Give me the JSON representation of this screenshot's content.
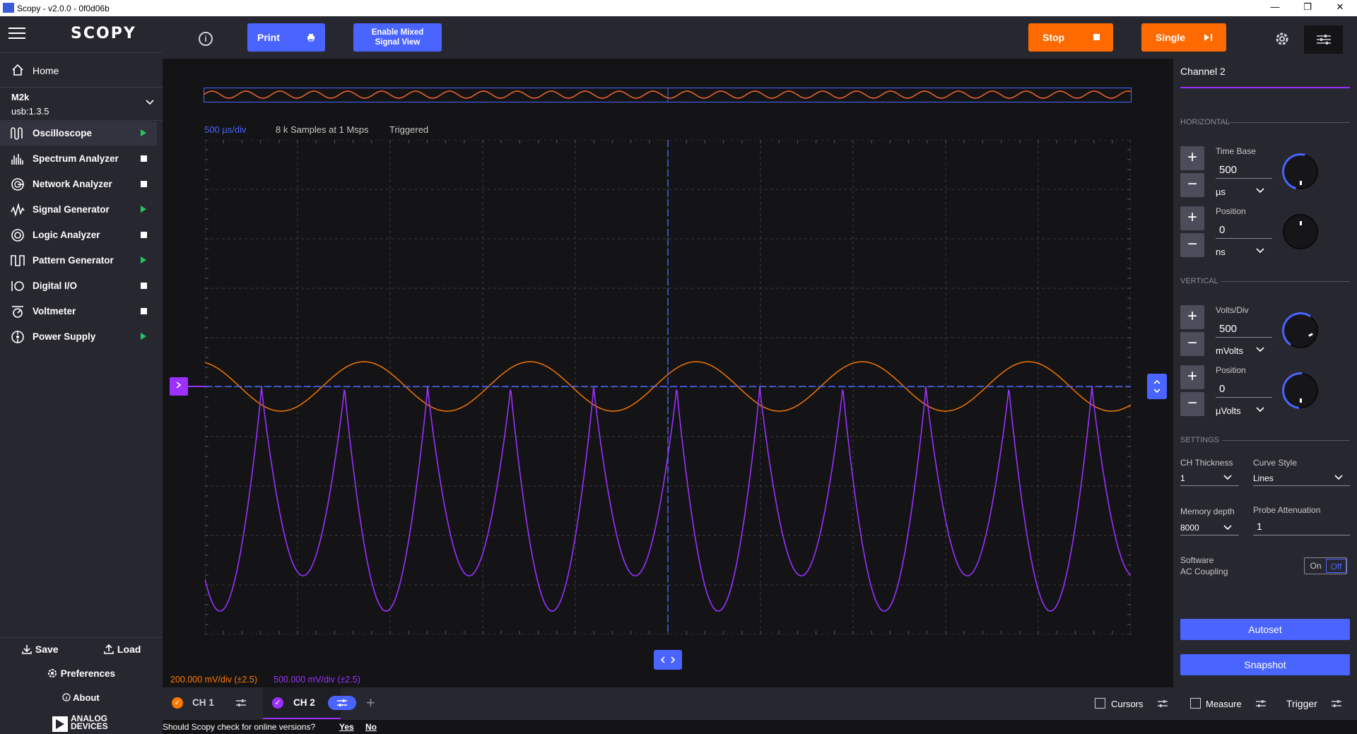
{
  "window": {
    "title": "Scopy - v2.0.0 - 0f0d06b",
    "minimize": "—",
    "maximize": "❐",
    "close": "✕"
  },
  "app": {
    "logo": "SCOPY"
  },
  "sidebar": {
    "home_label": "Home",
    "device": {
      "name": "M2k",
      "uri": "usb:1.3.5"
    },
    "tools": [
      {
        "label": "Oscilloscope",
        "state": "run"
      },
      {
        "label": "Spectrum Analyzer",
        "state": "stop"
      },
      {
        "label": "Network Analyzer",
        "state": "stop"
      },
      {
        "label": "Signal Generator",
        "state": "run"
      },
      {
        "label": "Logic Analyzer",
        "state": "stop"
      },
      {
        "label": "Pattern Generator",
        "state": "run"
      },
      {
        "label": "Digital I/O",
        "state": "stop"
      },
      {
        "label": "Voltmeter",
        "state": "stop"
      },
      {
        "label": "Power Supply",
        "state": "run"
      }
    ],
    "save_label": "Save",
    "load_label": "Load",
    "preferences_label": "Preferences",
    "about_label": "About",
    "vendor_line1": "ANALOG",
    "vendor_line2": "DEVICES"
  },
  "toolbar": {
    "info_label": "i",
    "print_label": "Print",
    "mixed_signal_line1": "Enable Mixed",
    "mixed_signal_line2": "Signal View",
    "stop_label": "Stop",
    "single_label": "Single"
  },
  "plot": {
    "timebase_label": "500 µs/div",
    "samples_label": "8 k Samples at 1 Msps",
    "trigger_status": "Triggered",
    "ch1_scale": "200.000 mV/div (±2.5)",
    "ch2_scale": "500.000 mV/div (±2.5)"
  },
  "right_panel": {
    "title": "Channel 2",
    "horizontal_label": "HORIZONTAL",
    "timebase": {
      "label": "Time Base",
      "value": "500",
      "unit": "µs"
    },
    "h_position": {
      "label": "Position",
      "value": "0",
      "unit": "ns"
    },
    "vertical_label": "VERTICAL",
    "volts_div": {
      "label": "Volts/Div",
      "value": "500",
      "unit": "mVolts"
    },
    "v_position": {
      "label": "Position",
      "value": "0",
      "unit": "µVolts"
    },
    "settings_label": "SETTINGS",
    "ch_thickness": {
      "label": "CH Thickness",
      "value": "1"
    },
    "curve_style": {
      "label": "Curve Style",
      "value": "Lines"
    },
    "memory_depth": {
      "label": "Memory depth",
      "value": "8000"
    },
    "probe_attenuation": {
      "label": "Probe Attenuation",
      "value": "1"
    },
    "ac_coupling": {
      "label_line1": "Software",
      "label_line2": "AC Coupling",
      "on": "On",
      "off": "Off"
    },
    "autoset_label": "Autoset",
    "snapshot_label": "Snapshot"
  },
  "channels_bar": {
    "ch1_label": "CH 1",
    "ch2_label": "CH 2",
    "add_label": "+",
    "cursors_label": "Cursors",
    "measure_label": "Measure",
    "trigger_label": "Trigger"
  },
  "update_prompt": {
    "question": "Should Scopy check for online versions?",
    "yes": "Yes",
    "no": "No"
  },
  "colors": {
    "accent": "#4a64ff",
    "ch1": "#ff7a00",
    "ch2": "#9b30ff",
    "run": "#22c55e"
  }
}
